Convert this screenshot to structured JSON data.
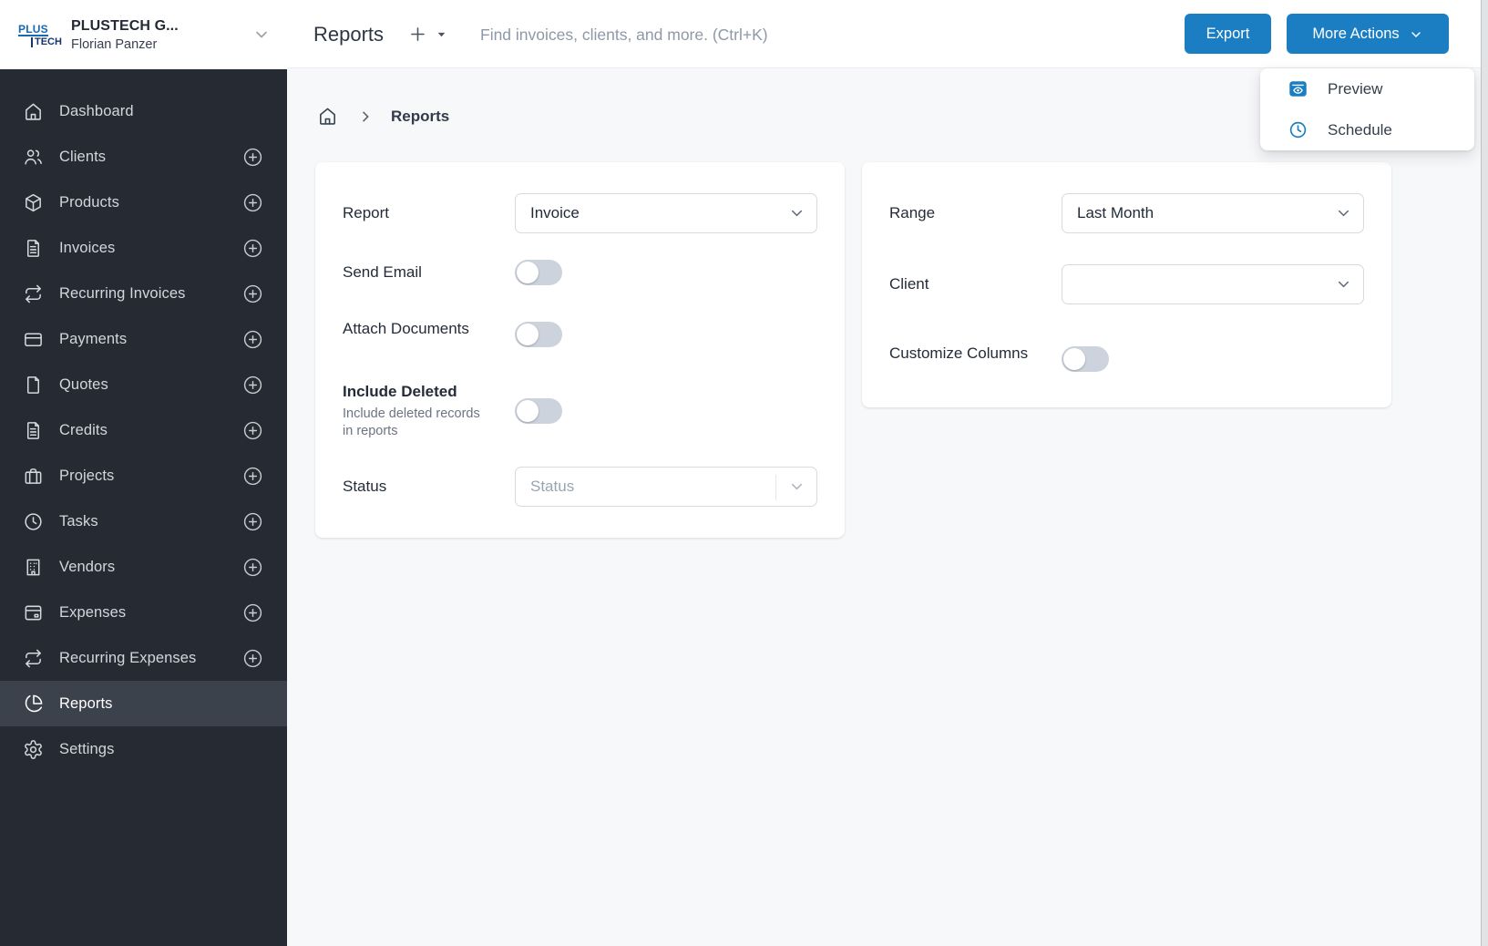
{
  "colors": {
    "accent_blue": "#1b7ec2",
    "sidebar_bg": "#252a33",
    "sidebar_active_bg": "#3c424c",
    "content_bg": "#f7f8fa"
  },
  "sidebar": {
    "logo": {
      "top": "PLUS",
      "bottom": "TECH"
    },
    "company_name": "PLUSTECH G...",
    "user_name": "Florian Panzer",
    "items": [
      {
        "label": "Dashboard",
        "icon": "home-icon",
        "has_add": false,
        "active": false
      },
      {
        "label": "Clients",
        "icon": "users-icon",
        "has_add": true,
        "active": false
      },
      {
        "label": "Products",
        "icon": "box-icon",
        "has_add": true,
        "active": false
      },
      {
        "label": "Invoices",
        "icon": "document-icon",
        "has_add": true,
        "active": false
      },
      {
        "label": "Recurring Invoices",
        "icon": "repeat-icon",
        "has_add": true,
        "active": false
      },
      {
        "label": "Payments",
        "icon": "credit-card-icon",
        "has_add": true,
        "active": false
      },
      {
        "label": "Quotes",
        "icon": "file-icon",
        "has_add": true,
        "active": false
      },
      {
        "label": "Credits",
        "icon": "document-icon",
        "has_add": true,
        "active": false
      },
      {
        "label": "Projects",
        "icon": "briefcase-icon",
        "has_add": true,
        "active": false
      },
      {
        "label": "Tasks",
        "icon": "clock-icon",
        "has_add": true,
        "active": false
      },
      {
        "label": "Vendors",
        "icon": "building-icon",
        "has_add": true,
        "active": false
      },
      {
        "label": "Expenses",
        "icon": "wallet-icon",
        "has_add": true,
        "active": false
      },
      {
        "label": "Recurring Expenses",
        "icon": "repeat-icon",
        "has_add": true,
        "active": false
      },
      {
        "label": "Reports",
        "icon": "pie-chart-icon",
        "has_add": false,
        "active": true
      },
      {
        "label": "Settings",
        "icon": "gear-icon",
        "has_add": false,
        "active": false
      }
    ]
  },
  "topbar": {
    "title": "Reports",
    "search_placeholder": "Find invoices, clients, and more. (Ctrl+K)",
    "export_button": "Export",
    "more_actions_button": "More Actions"
  },
  "actions_menu": {
    "items": [
      {
        "label": "Preview",
        "icon": "preview-icon"
      },
      {
        "label": "Schedule",
        "icon": "schedule-clock-icon"
      }
    ]
  },
  "breadcrumb": {
    "current": "Reports"
  },
  "report_card": {
    "report_label": "Report",
    "report_value": "Invoice",
    "send_email_label": "Send Email",
    "send_email_on": false,
    "attach_documents_label": "Attach Documents",
    "attach_documents_on": false,
    "include_deleted_label": "Include Deleted",
    "include_deleted_hint": "Include deleted records in reports",
    "include_deleted_on": false,
    "status_label": "Status",
    "status_placeholder": "Status"
  },
  "filter_card": {
    "range_label": "Range",
    "range_value": "Last Month",
    "client_label": "Client",
    "client_value": "",
    "customize_columns_label": "Customize Columns",
    "customize_columns_on": false
  }
}
